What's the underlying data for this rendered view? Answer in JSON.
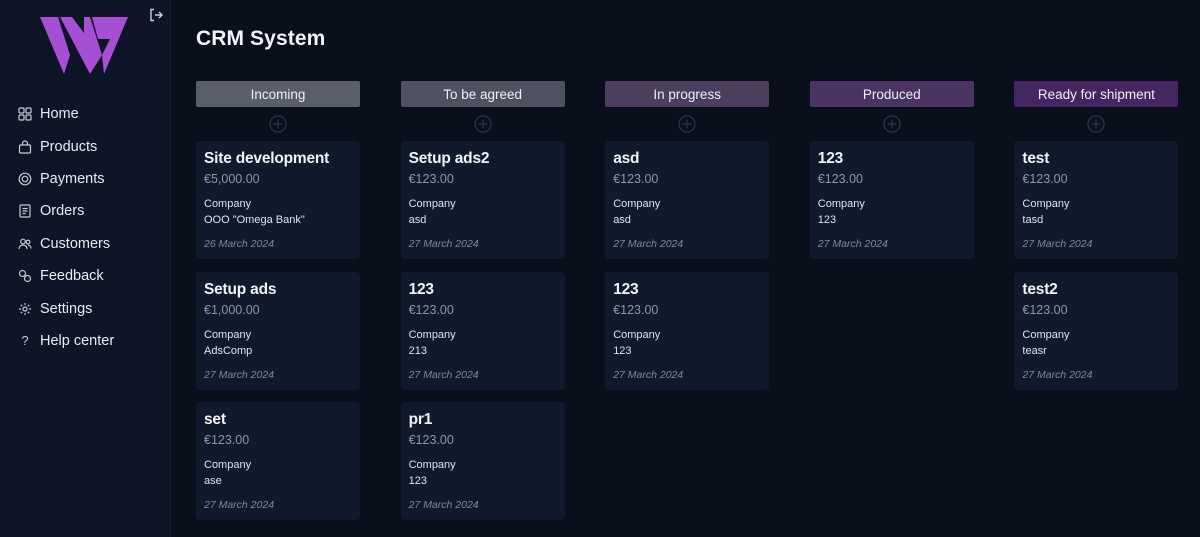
{
  "app": {
    "title": "CRM System"
  },
  "sidebar": {
    "items": [
      {
        "label": "Home",
        "icon": "grid-icon"
      },
      {
        "label": "Products",
        "icon": "bag-icon"
      },
      {
        "label": "Payments",
        "icon": "coin-icon"
      },
      {
        "label": "Orders",
        "icon": "document-icon"
      },
      {
        "label": "Customers",
        "icon": "users-icon"
      },
      {
        "label": "Feedback",
        "icon": "chat-icon"
      },
      {
        "label": "Settings",
        "icon": "gear-icon"
      },
      {
        "label": "Help center",
        "icon": "question-icon"
      }
    ]
  },
  "colors": {
    "background": "#0a0f1c",
    "sidebar": "#0e1526",
    "card": "#101a2c",
    "logo": "#a44fd4"
  },
  "columns": [
    {
      "title": "Incoming",
      "color": "#5a5e6b",
      "cards": [
        {
          "title": "Site development",
          "price": "€5,000.00",
          "company_label": "Company",
          "company": "OOO \"Omega Bank\"",
          "date": "26 March 2024"
        },
        {
          "title": "Setup ads",
          "price": "€1,000.00",
          "company_label": "Company",
          "company": "AdsComp",
          "date": "27 March 2024"
        },
        {
          "title": "set",
          "price": "€123.00",
          "company_label": "Company",
          "company": "ase",
          "date": "27 March 2024"
        }
      ]
    },
    {
      "title": "To be agreed",
      "color": "#4f5161",
      "cards": [
        {
          "title": "Setup ads2",
          "price": "€123.00",
          "company_label": "Company",
          "company": "asd",
          "date": "27 March 2024"
        },
        {
          "title": "123",
          "price": "€123.00",
          "company_label": "Company",
          "company": "213",
          "date": "27 March 2024"
        },
        {
          "title": "pr1",
          "price": "€123.00",
          "company_label": "Company",
          "company": "123",
          "date": "27 March 2024"
        }
      ]
    },
    {
      "title": "In progress",
      "color": "#4b3e5e",
      "cards": [
        {
          "title": "asd",
          "price": "€123.00",
          "company_label": "Company",
          "company": "asd",
          "date": "27 March 2024"
        },
        {
          "title": "123",
          "price": "€123.00",
          "company_label": "Company",
          "company": "123",
          "date": "27 March 2024"
        }
      ]
    },
    {
      "title": "Produced",
      "color": "#4a3462",
      "cards": [
        {
          "title": "123",
          "price": "€123.00",
          "company_label": "Company",
          "company": "123",
          "date": "27 March 2024"
        }
      ]
    },
    {
      "title": "Ready for shipment",
      "color": "#432662",
      "cards": [
        {
          "title": "test",
          "price": "€123.00",
          "company_label": "Company",
          "company": "tasd",
          "date": "27 March 2024"
        },
        {
          "title": "test2",
          "price": "€123.00",
          "company_label": "Company",
          "company": "teasr",
          "date": "27 March 2024"
        }
      ]
    }
  ]
}
